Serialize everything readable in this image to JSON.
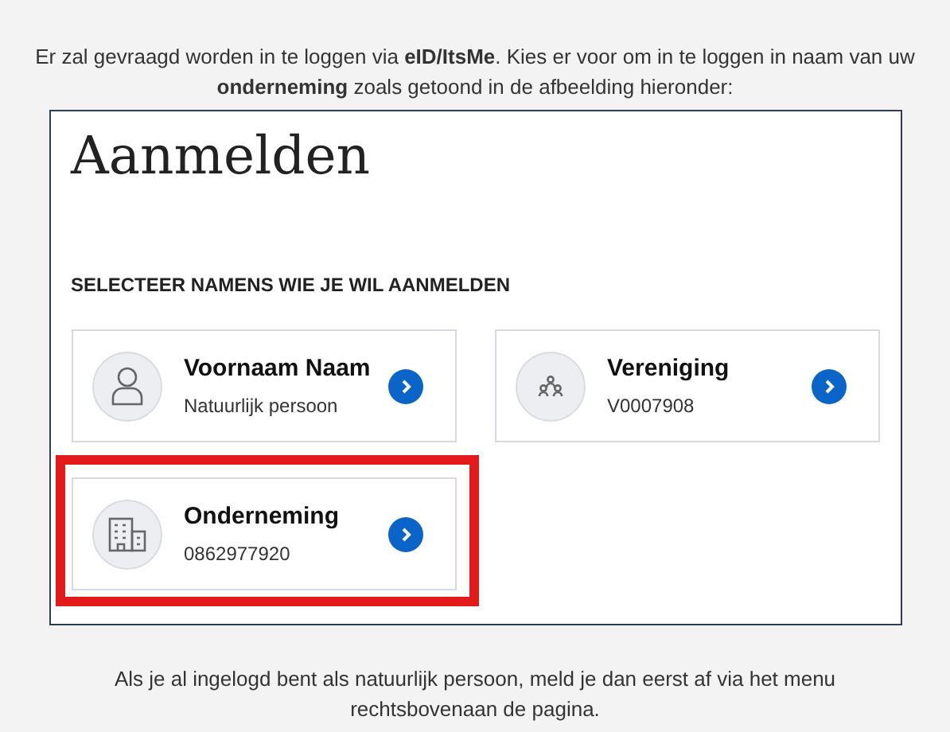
{
  "intro": "Er zal gevraagd worden in te loggen via **eID/ItsMe**. Kies er voor om in te loggen in naam van uw **onderneming** zoals getoond in de afbeelding hieronder:",
  "screenshot": {
    "title": "Aanmelden",
    "heading": "SELECTEER NAMENS WIE JE WIL AANMELDEN",
    "cards": [
      {
        "kind": "person",
        "name": "Voornaam Naam",
        "detail": "Natuurlijk persoon",
        "highlighted": false
      },
      {
        "kind": "association",
        "name": "Vereniging",
        "detail": "V0007908",
        "highlighted": false
      },
      {
        "kind": "company",
        "name": "Onderneming",
        "detail": "0862977920",
        "highlighted": true
      }
    ]
  },
  "note": "Als je al ingelogd bent als natuurlijk persoon, meld je dan eerst af via het menu rechtsbovenaan de pagina."
}
